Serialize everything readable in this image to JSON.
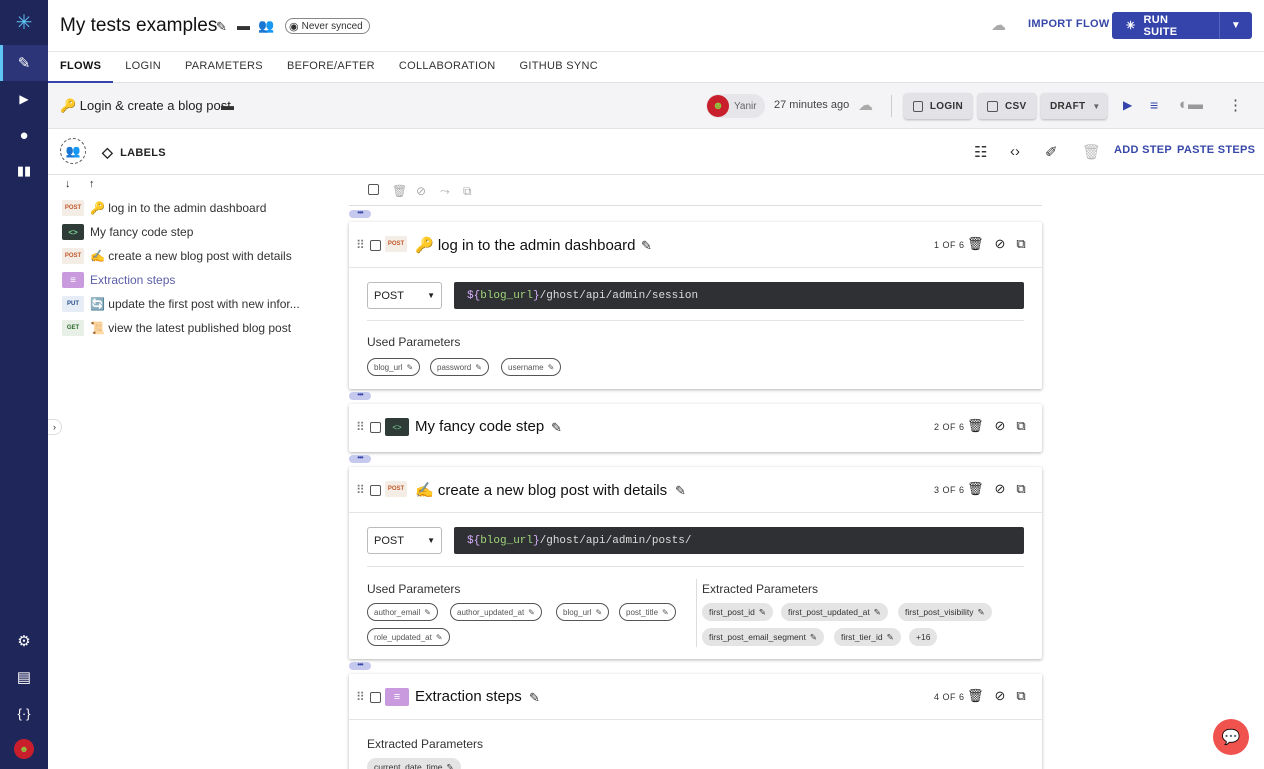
{
  "header": {
    "suite_title": "My tests examples",
    "sync_status": "Never synced",
    "import_flow": "IMPORT FLOW",
    "run_suite": "RUN SUITE"
  },
  "tabs": [
    "FLOWS",
    "LOGIN",
    "PARAMETERS",
    "BEFORE/AFTER",
    "COLLABORATION",
    "GITHUB SYNC"
  ],
  "flow": {
    "name": "🔑 Login & create a blog post",
    "user": "Yanir",
    "time": "27 minutes ago",
    "login_btn": "LOGIN",
    "csv_btn": "CSV",
    "draft_btn": "DRAFT"
  },
  "toolbar": {
    "labels": "LABELS",
    "add_step": "ADD STEP",
    "paste_steps": "PASTE STEPS"
  },
  "sidebar": {
    "items": [
      {
        "tag": "POST",
        "label": "🔑 log in to the admin dashboard"
      },
      {
        "tag": "<>",
        "label": "My fancy code step"
      },
      {
        "tag": "POST",
        "label": "✍️ create a new blog post with details"
      },
      {
        "tag": "≡",
        "label": "Extraction steps"
      },
      {
        "tag": "PUT",
        "label": "🔄 update the first post with new infor..."
      },
      {
        "tag": "GET",
        "label": "📜 view the latest published blog post"
      }
    ]
  },
  "steps": {
    "s1": {
      "tag": "POST",
      "title": "🔑 log in to the admin dashboard",
      "count": "1 OF 6",
      "method": "POST",
      "url_open": "${",
      "url_var": "blog_url",
      "url_close": "}",
      "url_path": "/ghost/api/admin/session",
      "used_label": "Used Parameters",
      "used": [
        "blog_url",
        "password",
        "username"
      ]
    },
    "s2": {
      "tag": "<>",
      "title": "My fancy code step",
      "count": "2 OF 6"
    },
    "s3": {
      "tag": "POST",
      "title": "✍️ create a new blog post with details",
      "count": "3 OF 6",
      "method": "POST",
      "url_open": "${",
      "url_var": "blog_url",
      "url_close": "}",
      "url_path": "/ghost/api/admin/posts/",
      "used_label": "Used Parameters",
      "used": [
        "author_email",
        "author_updated_at",
        "blog_url",
        "post_title",
        "role_updated_at"
      ],
      "extracted_label": "Extracted Parameters",
      "extracted": [
        "first_post_id",
        "first_post_updated_at",
        "first_post_visibility",
        "first_post_email_segment",
        "first_tier_id"
      ],
      "extracted_more": "+16"
    },
    "s4": {
      "tag": "≡",
      "title": "Extraction steps",
      "count": "4 OF 6",
      "extracted_label": "Extracted Parameters",
      "extracted": [
        "current_date_time"
      ]
    }
  },
  "colors": {
    "rail": "#1f2659",
    "accent": "#3544ab",
    "chat": "#f0524d"
  }
}
